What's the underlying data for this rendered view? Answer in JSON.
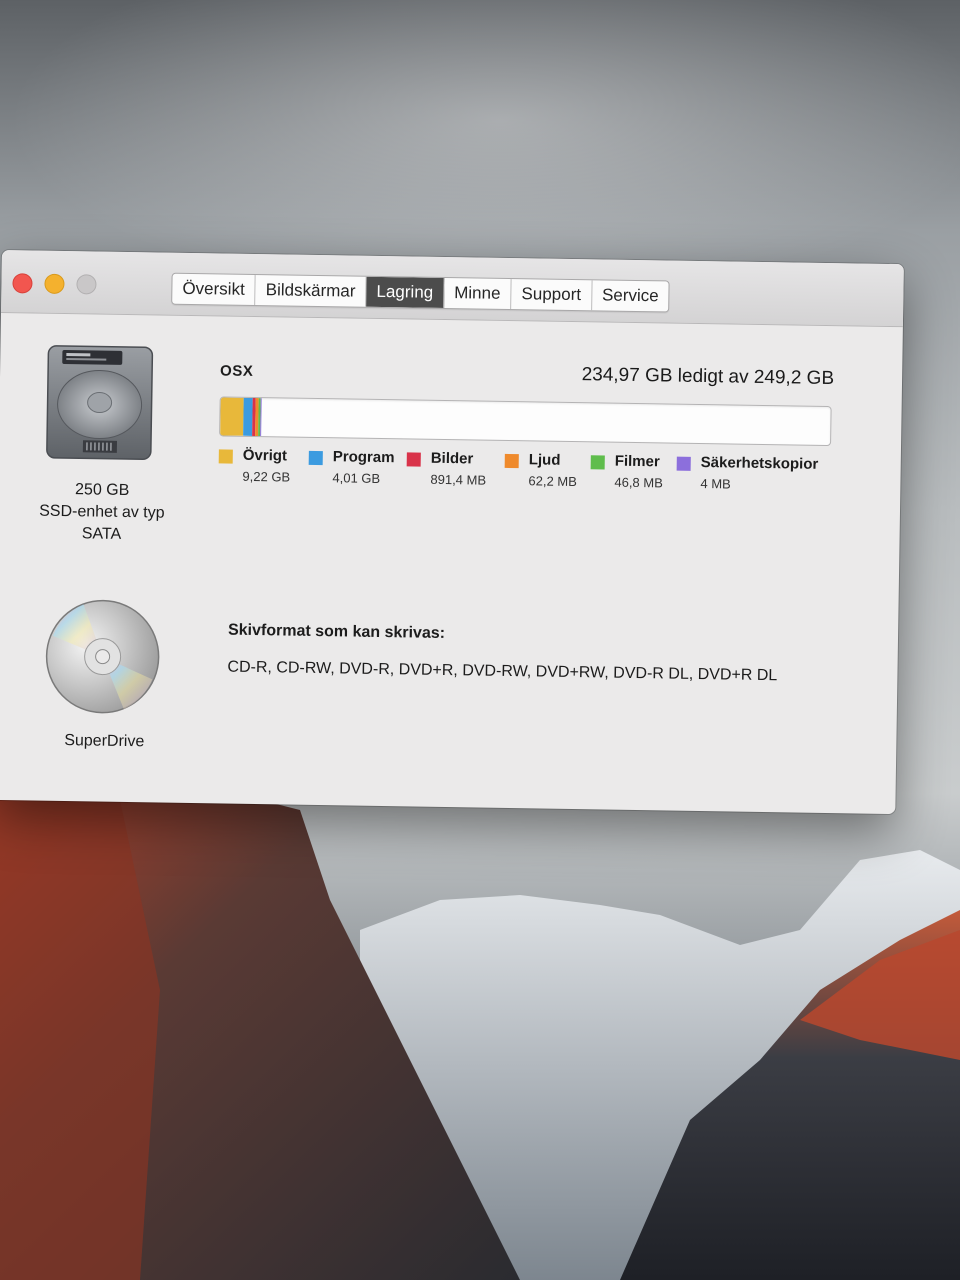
{
  "window": {
    "tabs": [
      {
        "label": "Översikt"
      },
      {
        "label": "Bildskärmar"
      },
      {
        "label": "Lagring"
      },
      {
        "label": "Minne"
      },
      {
        "label": "Support"
      },
      {
        "label": "Service"
      }
    ],
    "active_tab": "Lagring"
  },
  "disk": {
    "capacity": "250 GB",
    "type_line1": "SSD-enhet av typ",
    "type_line2": "SATA",
    "volume_name": "OSX",
    "free_text": "234,97 GB ledigt av 249,2 GB"
  },
  "usage": {
    "total_gb": 249.2,
    "categories": [
      {
        "label": "Övrigt",
        "size": "9,22 GB",
        "gb": 9.22,
        "color": "#e8b83a"
      },
      {
        "label": "Program",
        "size": "4,01 GB",
        "gb": 4.01,
        "color": "#3b9be0"
      },
      {
        "label": "Bilder",
        "size": "891,4 MB",
        "gb": 0.8914,
        "color": "#d9334a"
      },
      {
        "label": "Ljud",
        "size": "62,2 MB",
        "gb": 0.0622,
        "color": "#ef8a2c"
      },
      {
        "label": "Filmer",
        "size": "46,8 MB",
        "gb": 0.0468,
        "color": "#5fbd4c"
      },
      {
        "label": "Säkerhetskopior",
        "size": "4 MB",
        "gb": 0.004,
        "color": "#8c6fdc"
      }
    ]
  },
  "optical": {
    "label": "SuperDrive",
    "formats_title": "Skivformat som kan skrivas:",
    "formats": "CD-R, CD-RW, DVD-R, DVD+R, DVD-RW, DVD+RW, DVD-R DL, DVD+R DL"
  },
  "icons": {
    "close": "close-button",
    "minimize": "minimize-button",
    "zoom": "zoom-button",
    "hdd": "hard-drive-icon",
    "cd": "cd-disc-icon"
  }
}
